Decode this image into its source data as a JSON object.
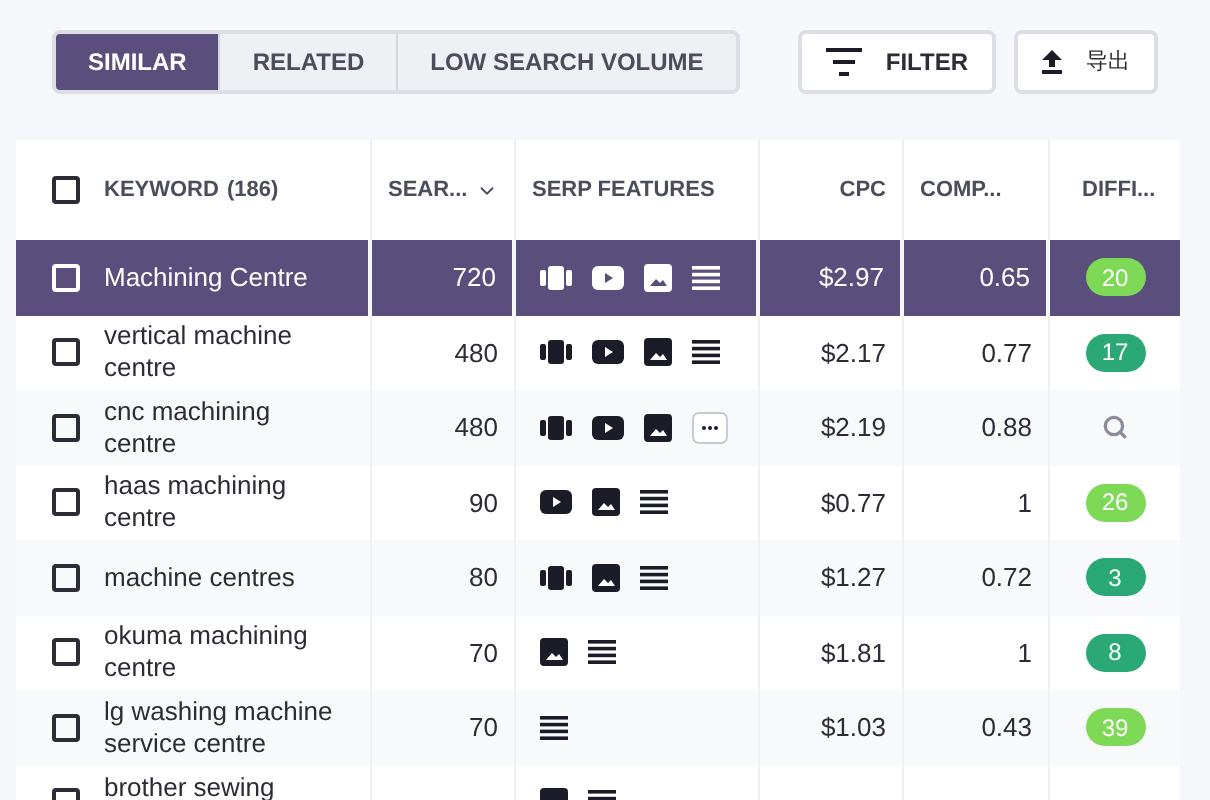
{
  "tabs": [
    {
      "label": "SIMILAR",
      "selected": true
    },
    {
      "label": "RELATED",
      "selected": false
    },
    {
      "label": "LOW SEARCH VOLUME",
      "selected": false
    }
  ],
  "actions": [
    {
      "kind": "filter",
      "label": "FILTER"
    },
    {
      "kind": "export",
      "label": "导出"
    }
  ],
  "table": {
    "select_all": {
      "checked": false
    },
    "columns": [
      {
        "label": "KEYWORD",
        "count": "(186)"
      },
      {
        "label": "SEAR...",
        "sortable": true
      },
      {
        "label": "SERP FEATURES"
      },
      {
        "label": "CPC"
      },
      {
        "label": "COMP..."
      },
      {
        "label": "DIFFI..."
      }
    ],
    "rows": [
      {
        "keyword": "Machining Centre",
        "volume": "720",
        "features": [
          {
            "kind": "carousel"
          },
          {
            "kind": "video"
          },
          {
            "kind": "image"
          },
          {
            "kind": "list"
          }
        ],
        "cpc": "$2.97",
        "competition": "0.65",
        "difficulty": {
          "kind": "score",
          "value": "20",
          "color": "#7ed957"
        },
        "checked": false,
        "selected": true
      },
      {
        "keyword": "vertical machine centre",
        "volume": "480",
        "features": [
          {
            "kind": "carousel"
          },
          {
            "kind": "video"
          },
          {
            "kind": "image"
          },
          {
            "kind": "list"
          }
        ],
        "cpc": "$2.17",
        "competition": "0.77",
        "difficulty": {
          "kind": "score",
          "value": "17",
          "color": "#2aa876"
        },
        "checked": false,
        "selected": false
      },
      {
        "keyword": "cnc machining centre",
        "volume": "480",
        "features": [
          {
            "kind": "carousel"
          },
          {
            "kind": "video"
          },
          {
            "kind": "image"
          },
          {
            "kind": "more"
          }
        ],
        "cpc": "$2.19",
        "competition": "0.88",
        "difficulty": {
          "kind": "search"
        },
        "checked": false,
        "selected": false
      },
      {
        "keyword": "haas machining centre",
        "volume": "90",
        "features": [
          {
            "kind": "video"
          },
          {
            "kind": "image"
          },
          {
            "kind": "list"
          }
        ],
        "cpc": "$0.77",
        "competition": "1",
        "difficulty": {
          "kind": "score",
          "value": "26",
          "color": "#7ed957"
        },
        "checked": false,
        "selected": false
      },
      {
        "keyword": "machine centres",
        "volume": "80",
        "features": [
          {
            "kind": "carousel"
          },
          {
            "kind": "image"
          },
          {
            "kind": "list"
          }
        ],
        "cpc": "$1.27",
        "competition": "0.72",
        "difficulty": {
          "kind": "score",
          "value": "3",
          "color": "#2aa876"
        },
        "checked": false,
        "selected": false
      },
      {
        "keyword": "okuma machining centre",
        "volume": "70",
        "features": [
          {
            "kind": "image"
          },
          {
            "kind": "list"
          }
        ],
        "cpc": "$1.81",
        "competition": "1",
        "difficulty": {
          "kind": "score",
          "value": "8",
          "color": "#2aa876"
        },
        "checked": false,
        "selected": false
      },
      {
        "keyword": "lg washing machine service centre",
        "volume": "70",
        "features": [
          {
            "kind": "list"
          }
        ],
        "cpc": "$1.03",
        "competition": "0.43",
        "difficulty": {
          "kind": "score",
          "value": "39",
          "color": "#7ed957"
        },
        "checked": false,
        "selected": false
      },
      {
        "keyword": "brother sewing",
        "features": [
          {
            "kind": "image"
          },
          {
            "kind": "list"
          }
        ],
        "checked": false,
        "selected": false
      }
    ]
  }
}
